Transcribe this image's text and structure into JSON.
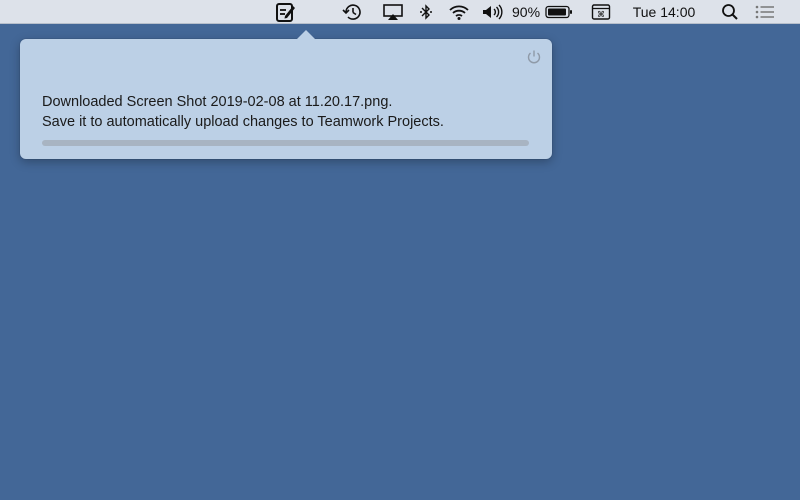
{
  "menubar": {
    "battery_percent": "90%",
    "clock": "Tue 14:00",
    "icons": [
      "teamwork-edit-icon",
      "time-machine-icon",
      "airplay-icon",
      "bluetooth-icon",
      "wifi-icon",
      "volume-icon",
      "battery-icon",
      "keyboard-input-icon",
      "spotlight-search-icon",
      "notification-center-icon"
    ]
  },
  "popover": {
    "line1": "Downloaded Screen Shot 2019-02-08 at 11.20.17.png.",
    "line2": "Save it to automatically upload changes to Teamwork Projects.",
    "progress": 0,
    "power_icon": "power-icon"
  },
  "colors": {
    "desktop": "#436797",
    "menubar": "#dde2ea",
    "popover": "#bcd0e6",
    "progress_track": "#a8b4c2"
  }
}
